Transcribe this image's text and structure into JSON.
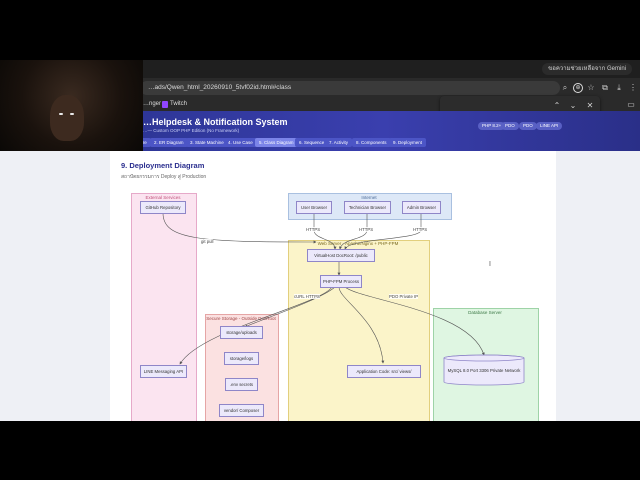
{
  "browser": {
    "gemini_button": "ขอความช่วยเหลือจาก Gemini",
    "url": "…ads/Qwen_html_20260910_5tvf02id.html#class",
    "bookmarks": [
      "…nger",
      "Twitch"
    ]
  },
  "app": {
    "title": "…Helpdesk & Notification System",
    "subtitle": "…— Custom OOP PHP Edition (No Framework)",
    "badges": [
      "PHP 8.2+",
      "PDO",
      "PDO",
      "LINE API"
    ],
    "nav": [
      "1. Architecture",
      "2. ER Diagram",
      "3. State Machine",
      "4. Use Case",
      "5. Class Diagram",
      "6. Sequence",
      "7. Activity",
      "8. Components",
      "9. Deployment"
    ],
    "active_nav": "5. Class Diagram"
  },
  "section": {
    "title": "9. Deployment Diagram",
    "description": "สถาปัตยกรรมการ Deploy สู่ Production"
  },
  "diagram": {
    "zones": {
      "external": "External Services",
      "internet": "Internet",
      "webserver": "Web Server - Apache/Nginx + PHP-FPM",
      "storage": "Secure Storage - Outside DocRoot",
      "database": "Database Server"
    },
    "nodes": {
      "github": "GitHub Repository",
      "user_browser": "User Browser",
      "tech_browser": "Technician Browser",
      "admin_browser": "Admin Browser",
      "vhost": "VirtualHost DocRoot: /public",
      "fpm": "PHP-FPM Process",
      "storage_uploads": "storage/uploads",
      "storage_logs": "storage/logs",
      "env": ".env secrets",
      "vendor": "vendor/ Composer",
      "line": "LINE Messaging API",
      "appcode": "Application Code: src/ views/",
      "mysql": "MySQL 8.0 Port 3306 Private Network"
    },
    "edges": {
      "gitpull": "git pull",
      "https1": "HTTPS",
      "https2": "HTTPS",
      "https3": "HTTPS",
      "curl": "cURL HTTPS",
      "pdo": "PDO Private IP"
    }
  },
  "colors": {
    "header": "#3a3fae",
    "external_fill": "#fbe4f0",
    "internet_fill": "#dde8f7",
    "web_fill": "#fbf4c9",
    "storage_fill": "#fbe1e1",
    "db_fill": "#dff6e2"
  }
}
